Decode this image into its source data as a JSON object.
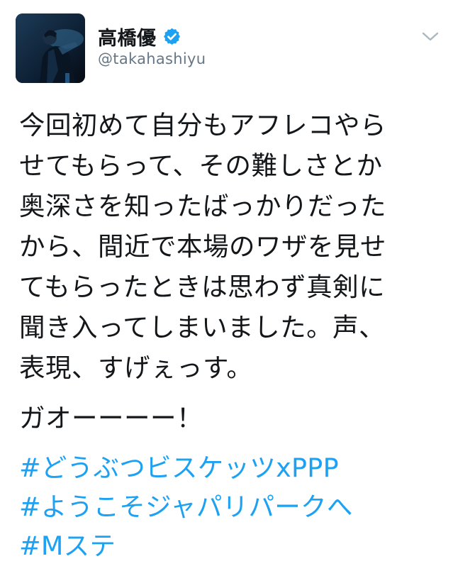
{
  "tweet": {
    "author": {
      "display_name": "高橋優",
      "handle": "@takahashiyu",
      "verified": true,
      "avatar_icon": "profile-photo"
    },
    "menu_icon": "chevron-down-icon",
    "body_lines": [
      "今回初めて自分もアフレコやら",
      "せてもらって、その難しさとか",
      "奥深さを知ったばっかりだった",
      "から、間近で本場のワザを見せ",
      "てもらったときは思わず真剣に",
      "聞き入ってしまいました。声、",
      "表現、すげぇっす。"
    ],
    "exclamation": "ガオーーーー！",
    "hashtags": [
      "#どうぶつビスケッツxPPP",
      "#ようこそジャパリパークへ",
      "#Mステ"
    ]
  },
  "colors": {
    "text": "#14171a",
    "secondary": "#657786",
    "link": "#1da1f2",
    "verified_badge": "#1da1f2"
  }
}
